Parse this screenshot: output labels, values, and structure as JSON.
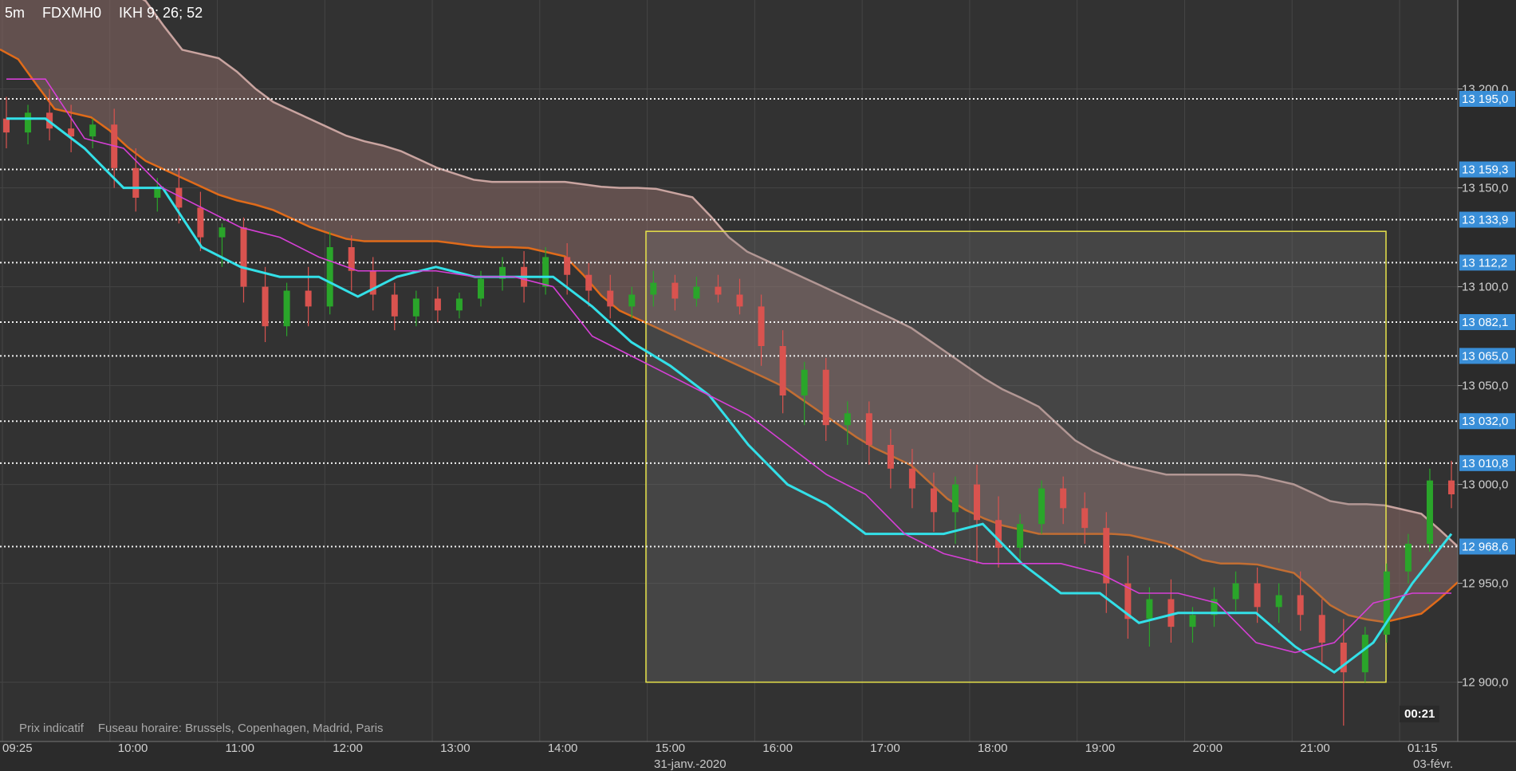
{
  "header": {
    "timeframe": "5m",
    "symbol": "FDXMH0",
    "indicator": "IKH 9; 26; 52"
  },
  "footer": {
    "price_note": "Prix indicatif",
    "timezone": "Fuseau horaire: Brussels, Copenhagen, Madrid, Paris"
  },
  "countdown": "00:21",
  "colors": {
    "background": "#323232",
    "bull": "#2aa52a",
    "bear": "#d9534f",
    "tenkan": "#33e0e8",
    "kijun": "#d63fd6",
    "span_a": "#e06b1a",
    "span_b": "#c9a4a0",
    "cloud": "#8a6a66",
    "level_label_bg": "#3a8fd8",
    "rect_border": "#e8e34a"
  },
  "chart_data": {
    "type": "candlestick",
    "ylim": [
      12870,
      13245
    ],
    "price_ticks": [
      "13 200,0",
      "13 150,0",
      "13 100,0",
      "13 050,0",
      "13 000,0",
      "12 950,0",
      "12 900,0"
    ],
    "level_labels": [
      "13 195,0",
      "13 159,3",
      "13 133,9",
      "13 112,2",
      "13 082,1",
      "13 065,0",
      "13 032,0",
      "13 010,8",
      "12 968,6"
    ],
    "levels": [
      13195.0,
      13159.3,
      13133.9,
      13112.2,
      13082.1,
      13065.0,
      13032.0,
      13010.8,
      12968.6
    ],
    "time_ticks": [
      "09:25",
      "10:00",
      "11:00",
      "12:00",
      "13:00",
      "14:00",
      "15:00",
      "16:00",
      "17:00",
      "18:00",
      "19:00",
      "20:00",
      "21:00",
      "01:15"
    ],
    "date_labels": [
      "31-janv.-2020",
      "03-févr."
    ],
    "highlight_box": {
      "price_top": 13128,
      "price_bottom": 12900
    },
    "series": [
      {
        "name": "Tenkan",
        "values": [
          13185,
          13185,
          13170,
          13150,
          13150,
          13120,
          13110,
          13105,
          13105,
          13095,
          13105,
          13110,
          13105,
          13105,
          13105,
          13090,
          13072,
          13060,
          13045,
          13020,
          13000,
          12990,
          12975,
          12975,
          12975,
          12980,
          12960,
          12945,
          12945,
          12930,
          12935,
          12935,
          12935,
          12918,
          12905,
          12920,
          12950,
          12975
        ]
      },
      {
        "name": "Kijun",
        "values": [
          13205,
          13205,
          13175,
          13170,
          13150,
          13140,
          13130,
          13125,
          13115,
          13108,
          13108,
          13108,
          13105,
          13105,
          13100,
          13075,
          13065,
          13055,
          13045,
          13035,
          13020,
          13005,
          12995,
          12975,
          12965,
          12960,
          12960,
          12960,
          12955,
          12945,
          12945,
          12940,
          12920,
          12915,
          12920,
          12940,
          12945,
          12945
        ]
      }
    ],
    "candles": [
      {
        "o": 13185,
        "h": 13196,
        "c": 13178,
        "l": 13170
      },
      {
        "o": 13178,
        "h": 13192,
        "c": 13188,
        "l": 13172
      },
      {
        "o": 13188,
        "h": 13200,
        "c": 13180,
        "l": 13174
      },
      {
        "o": 13180,
        "h": 13192,
        "c": 13176,
        "l": 13168
      },
      {
        "o": 13176,
        "h": 13185,
        "c": 13182,
        "l": 13170
      },
      {
        "o": 13182,
        "h": 13190,
        "c": 13160,
        "l": 13150
      },
      {
        "o": 13160,
        "h": 13170,
        "c": 13145,
        "l": 13138
      },
      {
        "o": 13145,
        "h": 13155,
        "c": 13150,
        "l": 13138
      },
      {
        "o": 13150,
        "h": 13160,
        "c": 13140,
        "l": 13132
      },
      {
        "o": 13140,
        "h": 13148,
        "c": 13125,
        "l": 13118
      },
      {
        "o": 13125,
        "h": 13132,
        "c": 13130,
        "l": 13110
      },
      {
        "o": 13130,
        "h": 13135,
        "c": 13100,
        "l": 13092
      },
      {
        "o": 13100,
        "h": 13110,
        "c": 13080,
        "l": 13072
      },
      {
        "o": 13080,
        "h": 13102,
        "c": 13098,
        "l": 13075
      },
      {
        "o": 13098,
        "h": 13110,
        "c": 13090,
        "l": 13080
      },
      {
        "o": 13090,
        "h": 13128,
        "c": 13120,
        "l": 13086
      },
      {
        "o": 13120,
        "h": 13126,
        "c": 13108,
        "l": 13098
      },
      {
        "o": 13108,
        "h": 13115,
        "c": 13096,
        "l": 13088
      },
      {
        "o": 13096,
        "h": 13102,
        "c": 13085,
        "l": 13078
      },
      {
        "o": 13085,
        "h": 13098,
        "c": 13094,
        "l": 13080
      },
      {
        "o": 13094,
        "h": 13100,
        "c": 13088,
        "l": 13082
      },
      {
        "o": 13088,
        "h": 13097,
        "c": 13094,
        "l": 13084
      },
      {
        "o": 13094,
        "h": 13108,
        "c": 13104,
        "l": 13090
      },
      {
        "o": 13104,
        "h": 13115,
        "c": 13110,
        "l": 13098
      },
      {
        "o": 13110,
        "h": 13118,
        "c": 13100,
        "l": 13092
      },
      {
        "o": 13100,
        "h": 13120,
        "c": 13115,
        "l": 13096
      },
      {
        "o": 13115,
        "h": 13122,
        "c": 13106,
        "l": 13096
      },
      {
        "o": 13106,
        "h": 13112,
        "c": 13098,
        "l": 13090
      },
      {
        "o": 13098,
        "h": 13106,
        "c": 13090,
        "l": 13084
      },
      {
        "o": 13090,
        "h": 13100,
        "c": 13096,
        "l": 13084
      },
      {
        "o": 13096,
        "h": 13108,
        "c": 13102,
        "l": 13090
      },
      {
        "o": 13102,
        "h": 13106,
        "c": 13094,
        "l": 13088
      },
      {
        "o": 13094,
        "h": 13105,
        "c": 13100,
        "l": 13090
      },
      {
        "o": 13100,
        "h": 13106,
        "c": 13096,
        "l": 13092
      },
      {
        "o": 13096,
        "h": 13104,
        "c": 13090,
        "l": 13086
      },
      {
        "o": 13090,
        "h": 13096,
        "c": 13070,
        "l": 13060
      },
      {
        "o": 13070,
        "h": 13078,
        "c": 13045,
        "l": 13036
      },
      {
        "o": 13045,
        "h": 13062,
        "c": 13058,
        "l": 13030
      },
      {
        "o": 13058,
        "h": 13064,
        "c": 13030,
        "l": 13022
      },
      {
        "o": 13030,
        "h": 13042,
        "c": 13036,
        "l": 13020
      },
      {
        "o": 13036,
        "h": 13042,
        "c": 13020,
        "l": 13010
      },
      {
        "o": 13020,
        "h": 13028,
        "c": 13008,
        "l": 12998
      },
      {
        "o": 13008,
        "h": 13018,
        "c": 12998,
        "l": 12988
      },
      {
        "o": 12998,
        "h": 13006,
        "c": 12986,
        "l": 12976
      },
      {
        "o": 12986,
        "h": 13004,
        "c": 13000,
        "l": 12970
      },
      {
        "o": 13000,
        "h": 13010,
        "c": 12982,
        "l": 12960
      },
      {
        "o": 12982,
        "h": 12994,
        "c": 12968,
        "l": 12958
      },
      {
        "o": 12968,
        "h": 12985,
        "c": 12980,
        "l": 12960
      },
      {
        "o": 12980,
        "h": 13002,
        "c": 12998,
        "l": 12975
      },
      {
        "o": 12998,
        "h": 13004,
        "c": 12988,
        "l": 12980
      },
      {
        "o": 12988,
        "h": 12996,
        "c": 12978,
        "l": 12970
      },
      {
        "o": 12978,
        "h": 12986,
        "c": 12950,
        "l": 12935
      },
      {
        "o": 12950,
        "h": 12964,
        "c": 12932,
        "l": 12922
      },
      {
        "o": 12932,
        "h": 12948,
        "c": 12942,
        "l": 12918
      },
      {
        "o": 12942,
        "h": 12952,
        "c": 12928,
        "l": 12920
      },
      {
        "o": 12928,
        "h": 12938,
        "c": 12934,
        "l": 12920
      },
      {
        "o": 12934,
        "h": 12948,
        "c": 12942,
        "l": 12928
      },
      {
        "o": 12942,
        "h": 12956,
        "c": 12950,
        "l": 12936
      },
      {
        "o": 12950,
        "h": 12958,
        "c": 12938,
        "l": 12930
      },
      {
        "o": 12938,
        "h": 12950,
        "c": 12944,
        "l": 12930
      },
      {
        "o": 12944,
        "h": 12956,
        "c": 12934,
        "l": 12926
      },
      {
        "o": 12934,
        "h": 12942,
        "c": 12920,
        "l": 12910
      },
      {
        "o": 12920,
        "h": 12932,
        "c": 12905,
        "l": 12878
      },
      {
        "o": 12905,
        "h": 12928,
        "c": 12924,
        "l": 12900
      },
      {
        "o": 12924,
        "h": 12960,
        "c": 12956,
        "l": 12920
      },
      {
        "o": 12956,
        "h": 12975,
        "c": 12970,
        "l": 12950
      },
      {
        "o": 12970,
        "h": 13008,
        "c": 13002,
        "l": 12966
      },
      {
        "o": 13002,
        "h": 13012,
        "c": 12995,
        "l": 12988
      }
    ]
  }
}
